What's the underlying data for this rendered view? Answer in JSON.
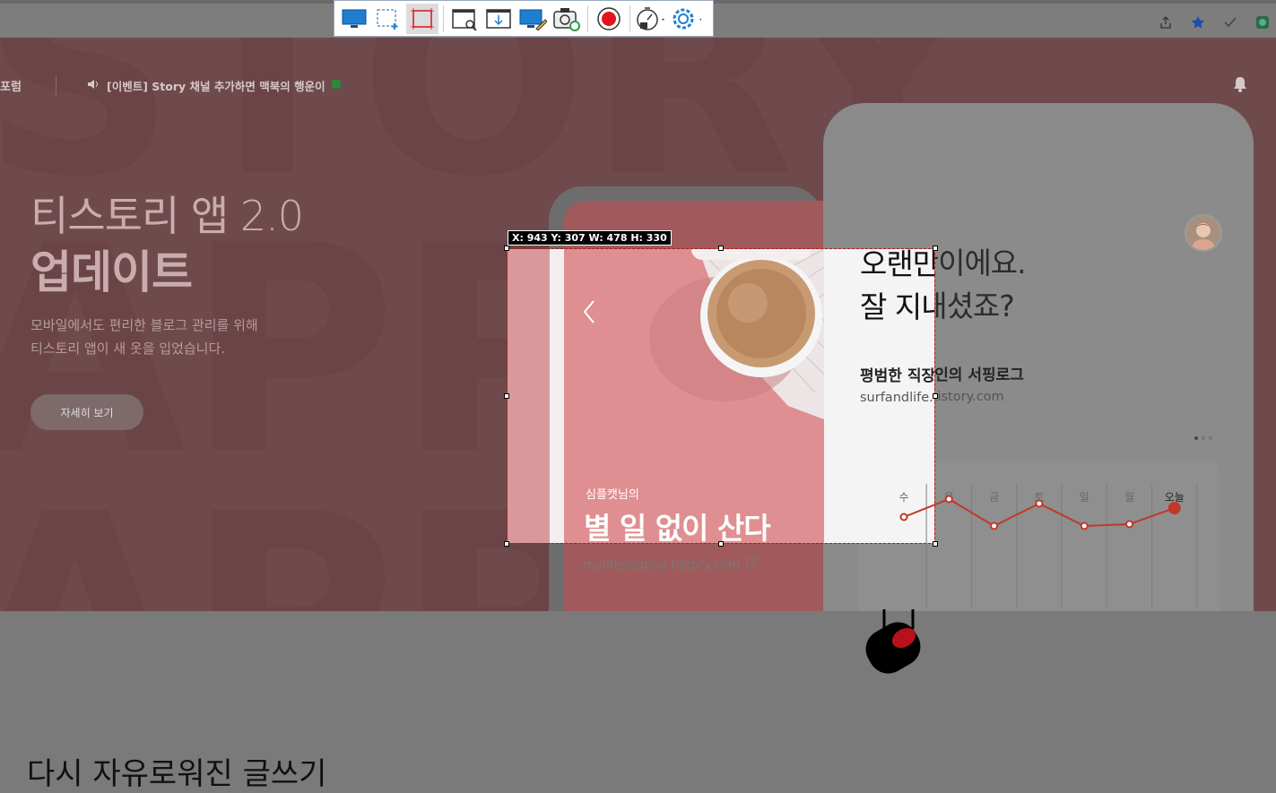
{
  "browser": {
    "icons": [
      "share-icon",
      "star-icon",
      "check-icon",
      "extension-icon"
    ]
  },
  "site": {
    "nav_forum": "포럼",
    "notice": "[이벤트] Story 채널 추가하면 맥북의 행운이",
    "hero": {
      "title_line1": "티스토리 앱 2.0",
      "title_line2": "업데이트",
      "desc_line1": "모바일에서도 편리한 블로그 관리를 위해",
      "desc_line2": "티스토리 앱이 새 옷을 입었습니다.",
      "button": "자세히 보기"
    },
    "back_phone": {
      "greet_line1": "오랜만이에요.",
      "greet_line2": "잘 지내셨죠?",
      "blog_name": "평범한 직장인의 서핑로그",
      "blog_url": "surfandlife.tistory.com",
      "chart_days": [
        "수",
        "목",
        "금",
        "토",
        "일",
        "월",
        "오늘"
      ]
    },
    "front_phone": {
      "owner": "심플캣님의",
      "post_title": "별 일 없이 산다",
      "url": "mylifesogood.tistory.com"
    },
    "bottom_text": "다시 자유로워진 글쓰기"
  },
  "chart_data": {
    "type": "line",
    "categories": [
      "수",
      "목",
      "금",
      "토",
      "일",
      "월",
      "오늘"
    ],
    "values": [
      3,
      5,
      2,
      4.5,
      2,
      2.2,
      4
    ],
    "accent": "#c0392b"
  },
  "snipping": {
    "coords": "X: 943 Y: 307 W: 478 H: 330",
    "tools": [
      "fullscreen-icon",
      "region-icon",
      "fixed-region-icon",
      "window-icon",
      "scroll-capture-icon",
      "screen-draw-icon",
      "camera-icon",
      "record-icon",
      "timer-icon",
      "settings-icon"
    ]
  }
}
